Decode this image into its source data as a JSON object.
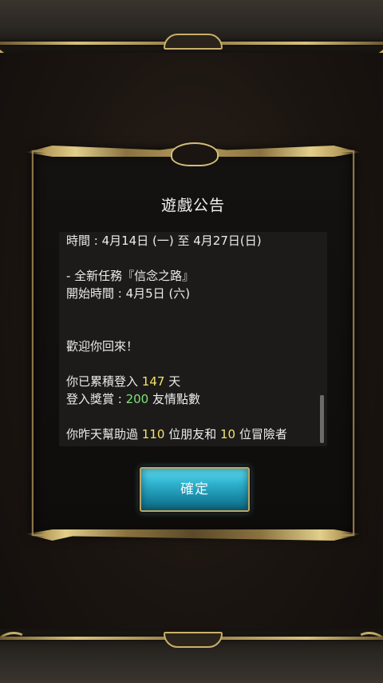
{
  "dialog": {
    "title": "遊戲公告",
    "confirm_label": "確定"
  },
  "notice": {
    "line1": "時間 : 4月14日 (一) 至 4月27日(日)",
    "line2": " - 全新任務『信念之路』",
    "line3": "開始時間 : 4月5日 (六)",
    "welcome": "歡迎你回來！",
    "login_prefix": "你已累積登入 ",
    "login_days": "147",
    "login_suffix": " 天",
    "reward_prefix": "登入獎賞 : ",
    "reward_points": "200",
    "reward_suffix": " 友情點數",
    "help_prefix": "你昨天幫助過 ",
    "help_friends": "110",
    "help_mid": " 位朋友和 ",
    "help_adventurers": "10",
    "help_suffix": " 位冒險者"
  },
  "colors": {
    "highlight_yellow": "#f3e36a",
    "highlight_green": "#7fe27a",
    "button_cyan": "#2fb3cf",
    "frame_gold": "#c9b06a"
  }
}
